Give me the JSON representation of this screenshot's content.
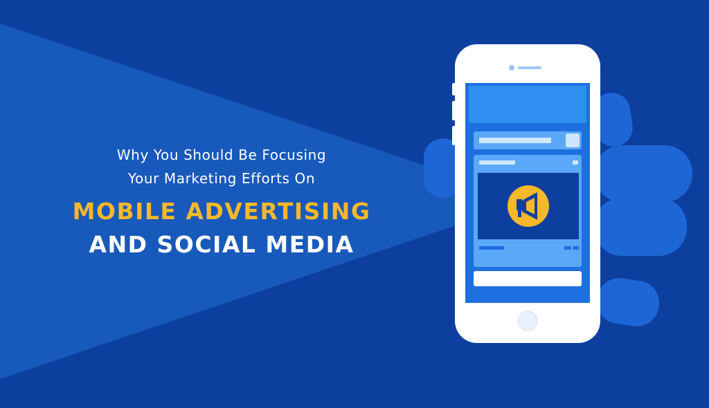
{
  "headline": {
    "subtitle_line_1": "Why You Should Be Focusing",
    "subtitle_line_2": "Your Marketing Efforts On",
    "highlight_line_1": "MOBILE ADVERTISING",
    "highlight_line_2": "AND SOCIAL MEDIA"
  },
  "colors": {
    "background": "#0d3f9f",
    "beam": "#1a5cbf",
    "highlight": "#f7b82a",
    "text": "#ffffff",
    "phone_body": "#ffffff",
    "screen": "#1e6fe0",
    "hand": "#1e66d6",
    "megaphone_circle": "#f7b82a"
  },
  "icons": {
    "megaphone": "megaphone-icon",
    "home_button": "home-button-icon",
    "camera": "front-camera-icon"
  }
}
